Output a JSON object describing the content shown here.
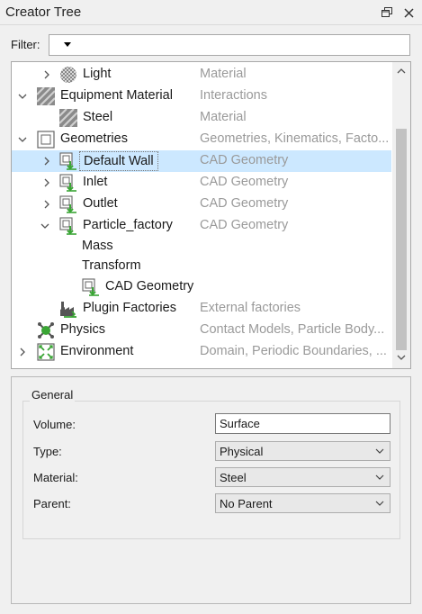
{
  "window": {
    "title": "Creator Tree"
  },
  "filter": {
    "label": "Filter:",
    "value": ""
  },
  "tree": {
    "rows": [
      {
        "label": "Light",
        "type": "Material"
      },
      {
        "label": "Equipment Material",
        "type": "Interactions"
      },
      {
        "label": "Steel",
        "type": "Material"
      },
      {
        "label": "Geometries",
        "type": "Geometries, Kinematics, Facto..."
      },
      {
        "label": "Default Wall",
        "type": "CAD Geometry"
      },
      {
        "label": "Inlet",
        "type": "CAD Geometry"
      },
      {
        "label": "Outlet",
        "type": "CAD Geometry"
      },
      {
        "label": "Particle_factory",
        "type": "CAD Geometry"
      },
      {
        "label": "Mass",
        "type": ""
      },
      {
        "label": "Transform",
        "type": ""
      },
      {
        "label": "CAD Geometry",
        "type": ""
      },
      {
        "label": "Plugin Factories",
        "type": "External factories"
      },
      {
        "label": "Physics",
        "type": "Contact Models, Particle Body..."
      },
      {
        "label": "Environment",
        "type": "Domain, Periodic Boundaries, ..."
      }
    ]
  },
  "properties": {
    "group_title": "General",
    "volume": {
      "label": "Volume:",
      "value": "Surface"
    },
    "type": {
      "label": "Type:",
      "value": "Physical"
    },
    "material": {
      "label": "Material:",
      "value": "Steel"
    },
    "parent": {
      "label": "Parent:",
      "value": "No Parent"
    }
  },
  "colors": {
    "selection": "#cce8ff",
    "type_text": "#9a9a9a",
    "accent_green": "#3aa535"
  }
}
